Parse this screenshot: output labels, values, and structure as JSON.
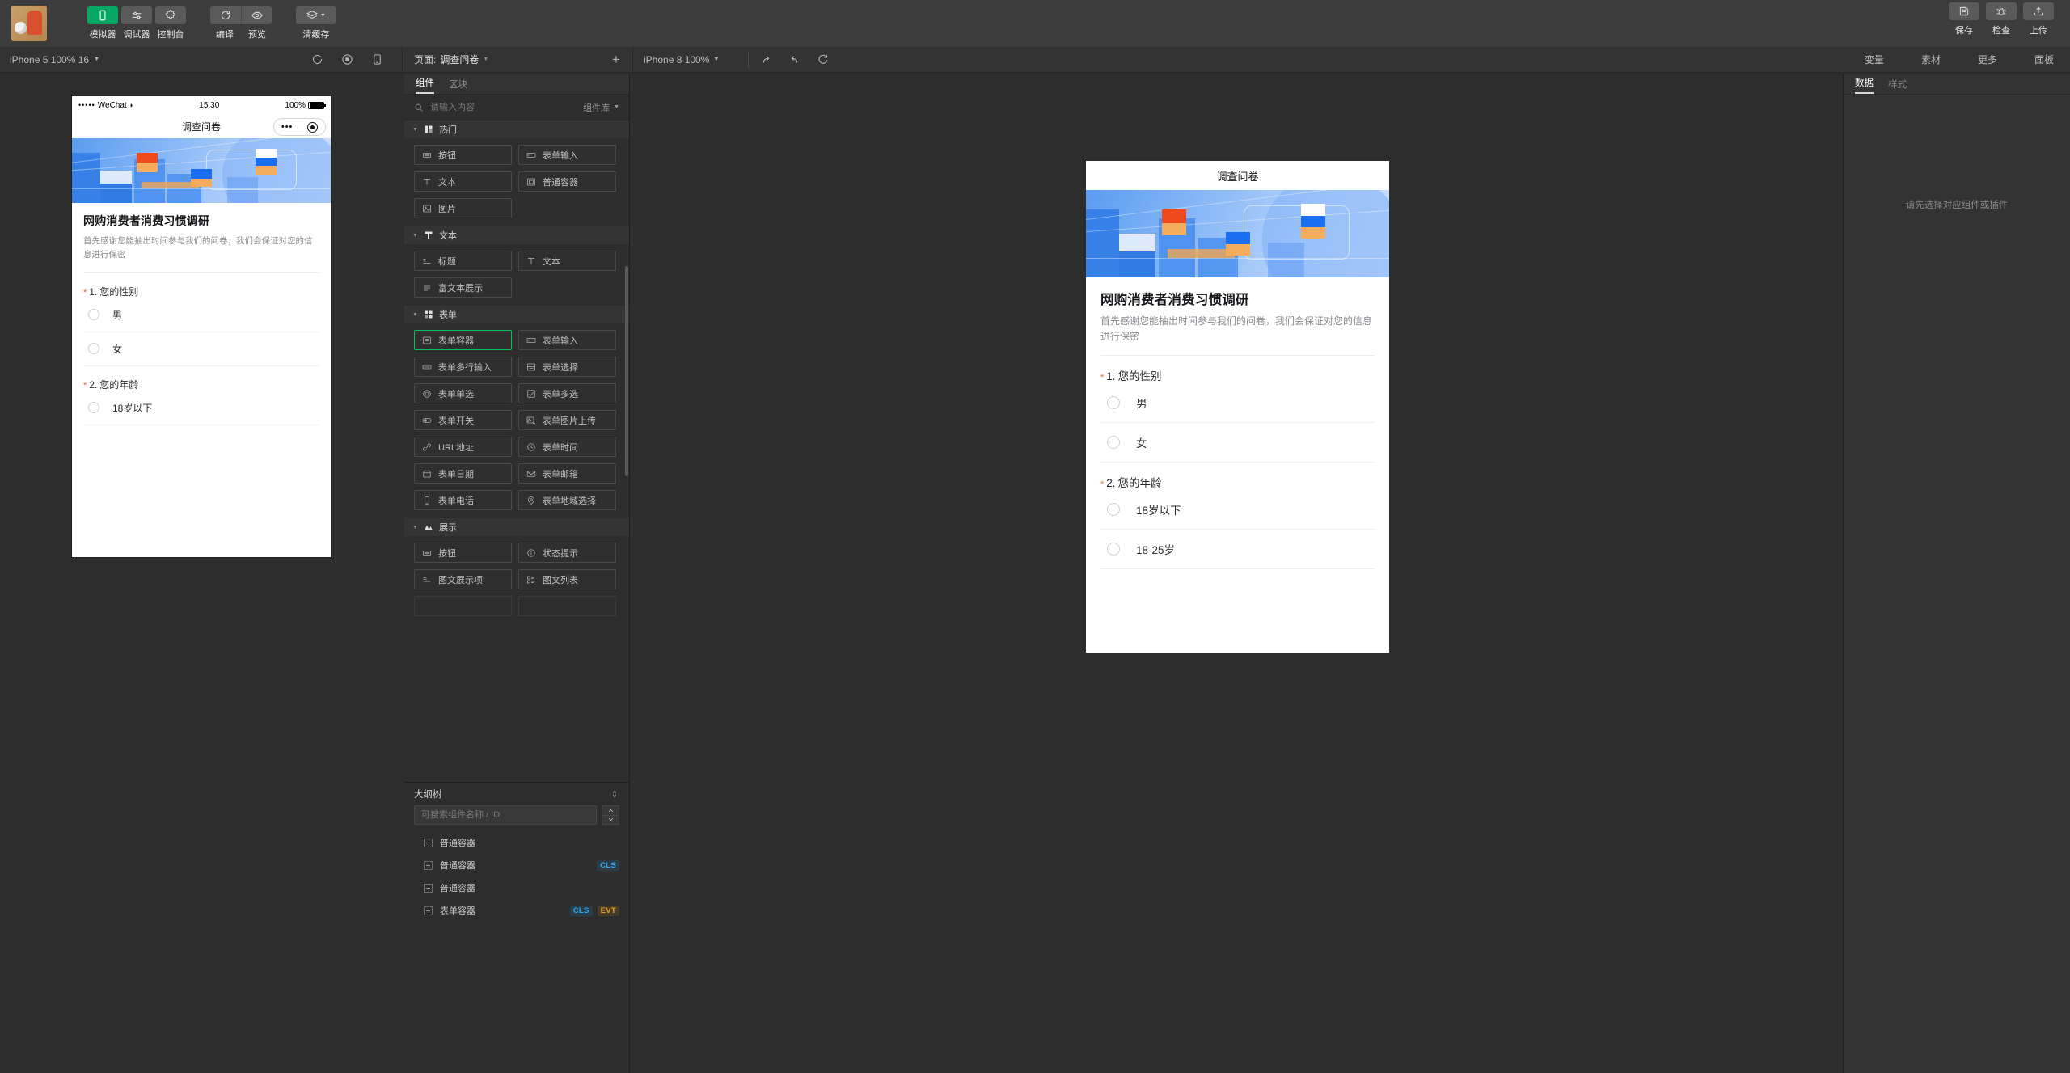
{
  "toolbar": {
    "groups": [
      {
        "buttons": [
          {
            "label": "模拟器",
            "icon": "phone-icon",
            "active": true
          },
          {
            "label": "调试器",
            "icon": "sliders-icon",
            "active": false
          },
          {
            "label": "控制台",
            "icon": "puzzle-icon",
            "active": false
          }
        ]
      },
      {
        "paired": true,
        "buttons": [
          {
            "label": "编译",
            "icon": "refresh-icon",
            "active": false
          },
          {
            "label": "预览",
            "icon": "eye-icon",
            "active": false
          }
        ]
      },
      {
        "buttons": [
          {
            "label": "清缓存",
            "icon": "layers-icon",
            "active": false,
            "caret": true
          }
        ]
      }
    ],
    "right_buttons": [
      {
        "label": "保存",
        "icon": "save-icon"
      },
      {
        "label": "检查",
        "icon": "bug-icon"
      },
      {
        "label": "上传",
        "icon": "upload-icon"
      }
    ]
  },
  "secondbar": {
    "simulator_device": "iPhone 5 100% 16",
    "sim_icons": [
      "refresh-icon",
      "record-stop-icon",
      "phone-frame-icon"
    ],
    "page_label": "页面:",
    "page_value": "调查问卷",
    "add_page": "+",
    "canvas_device": "iPhone 8 100%",
    "canvas_icons": [
      "redo-icon",
      "undo-icon",
      "reload-icon"
    ],
    "right_menu": [
      "变量",
      "素材",
      "更多",
      "面板"
    ]
  },
  "phone_preview": {
    "status": {
      "carrier_dots": "•••••",
      "carrier": "WeChat",
      "wifi": "wifi-icon",
      "time": "15:30",
      "battery_percent": "100%"
    },
    "nav_title": "调查问卷",
    "capsule_dots": "•••",
    "form": {
      "title": "网购消费者消费习惯调研",
      "subtitle": "首先感谢您能抽出时间参与我们的问卷，我们会保证对您的信息进行保密",
      "required_mark": "*",
      "questions": [
        {
          "number": "1.",
          "text": "您的性别",
          "options": [
            "男",
            "女"
          ]
        },
        {
          "number": "2.",
          "text": "您的年龄",
          "options": [
            "18岁以下",
            "18-25岁"
          ]
        }
      ]
    }
  },
  "components_panel": {
    "tabs": [
      {
        "label": "组件",
        "active": true
      },
      {
        "label": "区块",
        "active": false
      }
    ],
    "search_placeholder": "请输入内容",
    "search_value": "",
    "library_label": "组件库",
    "groups": [
      {
        "name": "热门",
        "icon": "grid-icon",
        "items": [
          {
            "label": "按钮",
            "icon": "button-icon"
          },
          {
            "label": "表单输入",
            "icon": "input-icon"
          },
          {
            "label": "文本",
            "icon": "text-t-icon"
          },
          {
            "label": "普通容器",
            "icon": "container-icon"
          },
          {
            "label": "图片",
            "icon": "image-icon"
          }
        ]
      },
      {
        "name": "文本",
        "icon": "text-t-icon",
        "items": [
          {
            "label": "标题",
            "icon": "heading-icon"
          },
          {
            "label": "文本",
            "icon": "text-t-icon"
          },
          {
            "label": "富文本展示",
            "icon": "richtext-icon"
          }
        ]
      },
      {
        "name": "表单",
        "icon": "grid-icon",
        "items": [
          {
            "label": "表单容器",
            "icon": "form-container-icon",
            "selected": true
          },
          {
            "label": "表单输入",
            "icon": "input-icon"
          },
          {
            "label": "表单多行输入",
            "icon": "textarea-icon"
          },
          {
            "label": "表单选择",
            "icon": "select-icon"
          },
          {
            "label": "表单单选",
            "icon": "radio-icon"
          },
          {
            "label": "表单多选",
            "icon": "checkbox-icon"
          },
          {
            "label": "表单开关",
            "icon": "switch-icon"
          },
          {
            "label": "表单图片上传",
            "icon": "image-upload-icon"
          },
          {
            "label": "URL地址",
            "icon": "link-icon"
          },
          {
            "label": "表单时间",
            "icon": "clock-icon"
          },
          {
            "label": "表单日期",
            "icon": "calendar-icon"
          },
          {
            "label": "表单邮箱",
            "icon": "mail-icon"
          },
          {
            "label": "表单电话",
            "icon": "phone-icon"
          },
          {
            "label": "表单地域选择",
            "icon": "location-icon"
          }
        ]
      },
      {
        "name": "展示",
        "icon": "mountain-icon",
        "items": [
          {
            "label": "按钮",
            "icon": "button-icon"
          },
          {
            "label": "状态提示",
            "icon": "info-icon"
          },
          {
            "label": "图文展示项",
            "icon": "media-item-icon"
          },
          {
            "label": "图文列表",
            "icon": "media-list-icon"
          }
        ]
      }
    ]
  },
  "outline": {
    "title": "大纲树",
    "collapse_icon": "expand-collapse-icon",
    "search_placeholder": "可搜索组件名称 / ID",
    "search_value": "",
    "rows": [
      {
        "label": "普通容器",
        "badges": []
      },
      {
        "label": "普通容器",
        "badges": [
          "CLS"
        ]
      },
      {
        "label": "普通容器",
        "badges": []
      },
      {
        "label": "表单容器",
        "badges": [
          "CLS",
          "EVT"
        ]
      }
    ]
  },
  "right_panel": {
    "tabs": [
      {
        "label": "数据",
        "active": true
      },
      {
        "label": "样式",
        "active": false
      }
    ],
    "empty_text": "请先选择对应组件或插件"
  },
  "colors": {
    "accent_green": "#07c160",
    "required_orange": "#f56a30",
    "badge_cls": "#29a8f5",
    "badge_evt": "#f0a020",
    "panel_bg": "#2d2d2d",
    "toolbar_bg": "#3c3c3c"
  }
}
